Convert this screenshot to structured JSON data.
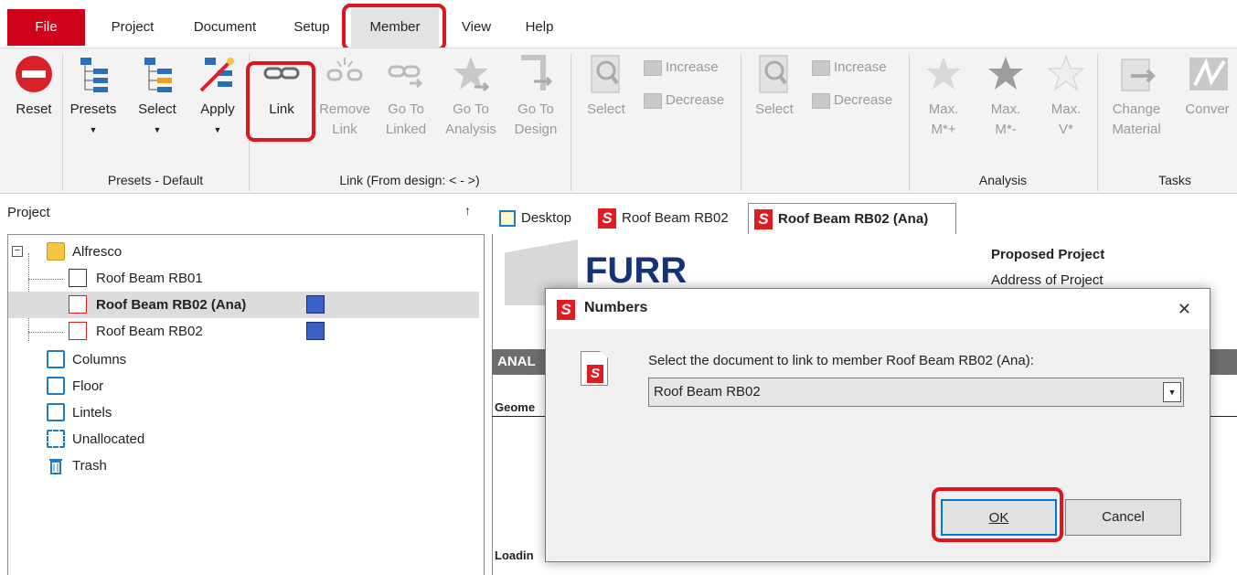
{
  "menu": {
    "file": "File",
    "project": "Project",
    "document": "Document",
    "setup": "Setup",
    "member": "Member",
    "view": "View",
    "help": "Help"
  },
  "ribbon": {
    "reset": "Reset",
    "presets": "Presets",
    "select": "Select",
    "apply": "Apply",
    "link": "Link",
    "remove_link": "Remove\nLink",
    "go_to_linked": "Go To\nLinked",
    "go_to_analysis": "Go To\nAnalysis",
    "go_to_design": "Go To\nDesign",
    "select2": "Select",
    "increase": "Increase",
    "decrease": "Decrease",
    "select3": "Select",
    "increase2": "Increase",
    "decrease2": "Decrease",
    "max_m_plus": "Max.\nM*+",
    "max_m_minus": "Max.\nM*-",
    "max_v": "Max.\nV*",
    "change_material": "Change\nMaterial",
    "conver": "Conver",
    "group_presets": "Presets - Default",
    "group_link": "Link (From design: < - >)",
    "group_analysis": "Analysis",
    "group_tasks": "Tasks"
  },
  "project_panel": {
    "title": "Project",
    "pin": "↑",
    "tree": {
      "alfresco": "Alfresco",
      "rb01": "Roof Beam RB01",
      "rb02_ana": "Roof Beam RB02  (Ana)",
      "rb02": "Roof Beam RB02",
      "columns": "Columns",
      "floor": "Floor",
      "lintels": "Lintels",
      "unallocated": "Unallocated",
      "trash": "Trash"
    }
  },
  "tabs": {
    "desktop": "Desktop",
    "rb02": "Roof Beam RB02",
    "rb02_ana": "Roof Beam RB02 (Ana)"
  },
  "document": {
    "logo_text": "FURR",
    "project_title": "Proposed Project",
    "project_address": "Address of Project",
    "analysis_bar": "ANAL",
    "geometry": "Geome",
    "loading": "Loadin"
  },
  "dialog": {
    "title": "Numbers",
    "close": "✕",
    "prompt": "Select the document to link to member Roof Beam RB02 (Ana):",
    "selected_value": "Roof Beam RB02",
    "ok": "OK",
    "cancel": "Cancel"
  },
  "colors": {
    "file_menu": "#d0011b",
    "highlight": "#e0141e",
    "brand_red": "#e01b22",
    "logo_blue": "#16337a"
  }
}
